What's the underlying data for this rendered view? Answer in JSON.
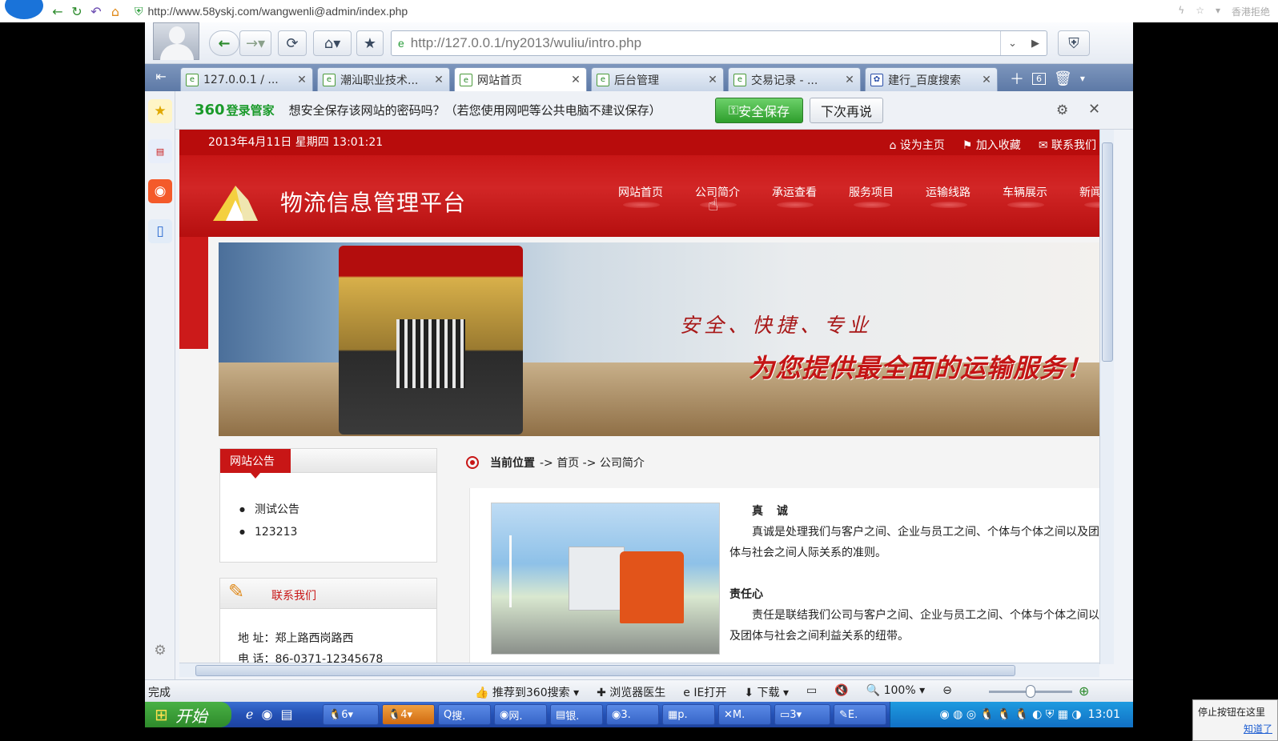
{
  "outer": {
    "url": "http://www.58yskj.com/wangwenli@admin/index.php",
    "right_text": "香港拒绝"
  },
  "toolbar": {
    "address": "http://127.0.0.1/ny2013/wuliu/intro.php"
  },
  "tabs": [
    {
      "label": "127.0.0.1 / ..."
    },
    {
      "label": "潮汕职业技术..."
    },
    {
      "label": "网站首页"
    },
    {
      "label": "后台管理"
    },
    {
      "label": "交易记录 - ..."
    },
    {
      "label": "建行_百度搜索"
    }
  ],
  "tab_count": "6",
  "pwbar": {
    "brand": "360",
    "brand_sub": "登录管家",
    "message": "想安全保存该网站的密码吗？（若您使用网吧等公共电脑不建议保存）",
    "save": "安全保存",
    "later": "下次再说"
  },
  "site": {
    "date": "2013年4月11日  星期四  13:01:21",
    "top_links": [
      "设为主页",
      "加入收藏",
      "联系我们"
    ],
    "title": "物流信息管理平台",
    "nav": [
      "网站首页",
      "公司简介",
      "承运查看",
      "服务项目",
      "运输线路",
      "车辆展示",
      "新闻"
    ],
    "slogan1": "安全、快捷、专业",
    "slogan2": "为您提供最全面的运输服务！",
    "notice": {
      "title": "网站公告",
      "items": [
        "测试公告",
        "123213"
      ]
    },
    "contact": {
      "title": "联系我们",
      "address": "地  址：郑上路西岗路西",
      "tel": "电  话：86-0371-12345678"
    },
    "crumb": {
      "label": "当前位置",
      "path": "-> 首页  -> 公司简介"
    },
    "article": {
      "h1": "真 诚",
      "p1": "真诚是处理我们与客户之间、企业与员工之间、个体与个体之间以及团体与社会之间人际关系的准则。",
      "h2": "责任心",
      "p2": "责任是联结我们公司与客户之间、企业与员工之间、个体与个体之间以及团体与社会之间利益关系的纽带。"
    }
  },
  "status": {
    "text": "完成",
    "items": [
      "推荐到360搜索",
      "浏览器医生",
      "IE打开",
      "下载",
      "100%"
    ]
  },
  "taskbar": {
    "start": "开始",
    "tasks": [
      "6",
      "4",
      "搜.",
      "网.",
      "银.",
      "3.",
      "p.",
      "M.",
      "3",
      "E."
    ],
    "clock": "13:01"
  },
  "tip": {
    "text": "停止按钮在这里",
    "link": "知道了"
  }
}
